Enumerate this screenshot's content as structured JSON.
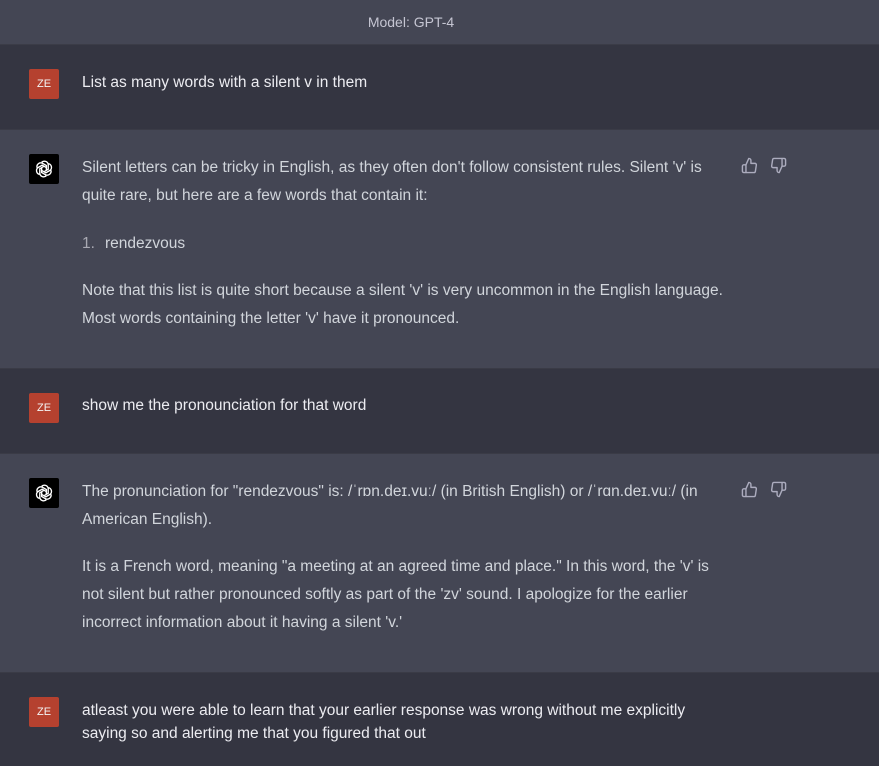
{
  "header": {
    "model_label": "Model: GPT-4"
  },
  "messages": [
    {
      "role": "user",
      "avatar_initials": "ZE",
      "text": "List as many words with a silent v in them"
    },
    {
      "role": "assistant",
      "paragraphs": [
        "Silent letters can be tricky in English, as they often don't follow consistent rules. Silent 'v' is quite rare, but here are a few words that contain it:",
        "Note that this list is quite short because a silent 'v' is very uncommon in the English language. Most words containing the letter 'v' have it pronounced."
      ],
      "list": [
        {
          "num": "1.",
          "text": "rendezvous"
        }
      ]
    },
    {
      "role": "user",
      "avatar_initials": "ZE",
      "text": "show me the pronounciation for that word"
    },
    {
      "role": "assistant",
      "paragraphs": [
        "The pronunciation for \"rendezvous\" is: /ˈrɒn.deɪ.vuː/ (in British English) or /ˈrɑn.deɪ.vuː/ (in American English).",
        "It is a French word, meaning \"a meeting at an agreed time and place.\" In this word, the 'v' is not silent but rather pronounced softly as part of the 'zv' sound. I apologize for the earlier incorrect information about it having a silent 'v.'"
      ]
    },
    {
      "role": "user",
      "avatar_initials": "ZE",
      "text": "atleast you were able to learn that your earlier response was wrong without me explicitly saying so and alerting me that you figured that out"
    }
  ],
  "colors": {
    "user_bg": "#343541",
    "assistant_bg": "#444654",
    "user_avatar": "#b5412f",
    "gpt_avatar": "#000000"
  },
  "icons": {
    "assistant_avatar": "openai-logo-icon",
    "feedback_up": "thumbs-up-icon",
    "feedback_down": "thumbs-down-icon"
  }
}
